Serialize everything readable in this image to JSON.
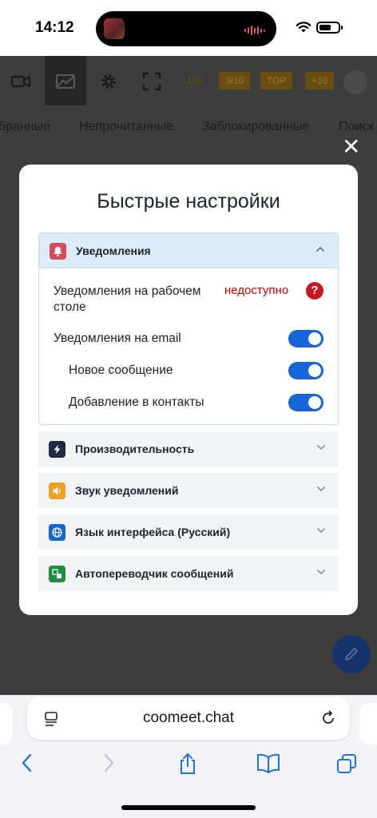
{
  "status": {
    "time": "14:12"
  },
  "app": {
    "counter": "100",
    "badges": [
      "3/10",
      "TOP",
      "+10"
    ],
    "tabs": [
      "бранные",
      "Непрочитанные",
      "Заблокированные",
      "Поиск"
    ]
  },
  "modal": {
    "title": "Быстрые настройки",
    "notifications": {
      "label": "Уведомления",
      "desktop_label_line1": "Уведомления на рабочем",
      "desktop_label_line2": "столе",
      "desktop_status": "недоступно",
      "help_glyph": "?",
      "email_label": "Уведомления на email",
      "email_on": true,
      "new_message_label": "Новое сообщение",
      "new_message_on": true,
      "add_contacts_label": "Добавление в контакты",
      "add_contacts_on": true
    },
    "sections": [
      {
        "label": "Производительность",
        "icon": "lightning-icon",
        "color": "#1f2a44"
      },
      {
        "label": "Звук уведомлений",
        "icon": "speaker-icon",
        "color": "#f0a020"
      },
      {
        "label": "Язык интерфейса (Русский)",
        "icon": "globe-icon",
        "color": "#1565d8"
      },
      {
        "label": "Автопереводчик сообщений",
        "icon": "translate-icon",
        "color": "#1e8e3e"
      }
    ]
  },
  "browser": {
    "url": "coomeet.chat"
  },
  "colors": {
    "accent": "#1565d8",
    "notify_icon": "#d64b5c",
    "error": "#cc0000"
  }
}
